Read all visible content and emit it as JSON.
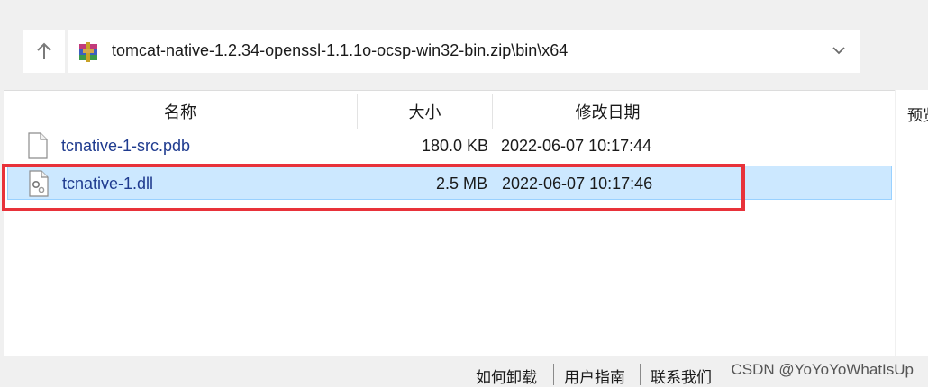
{
  "toolbar": {
    "up_icon": "arrow-up-icon",
    "address_path": "tomcat-native-1.2.34-openssl-1.1.1o-ocsp-win32-bin.zip\\bin\\x64",
    "archive_icon": "winrar-archive-icon",
    "dropdown_icon": "chevron-down-icon"
  },
  "columns": {
    "name": "名称",
    "size": "大小",
    "modified": "修改日期"
  },
  "files": [
    {
      "name": "tcnative-1-src.pdb",
      "size": "180.0 KB",
      "modified": "2022-06-07 10:17:44",
      "icon": "file-icon"
    },
    {
      "name": "tcnative-1.dll",
      "size": "2.5 MB",
      "modified": "2022-06-07 10:17:46",
      "icon": "dll-file-icon"
    }
  ],
  "preview": {
    "label": "预览"
  },
  "footer": {
    "links": [
      "如何卸载",
      "用户指南",
      "联系我们"
    ],
    "watermark": "CSDN @YoYoYoWhatIsUp"
  },
  "colors": {
    "selection": "#cce8ff",
    "highlight_box": "#e8323a",
    "file_name_text": "#1f3b8f"
  }
}
